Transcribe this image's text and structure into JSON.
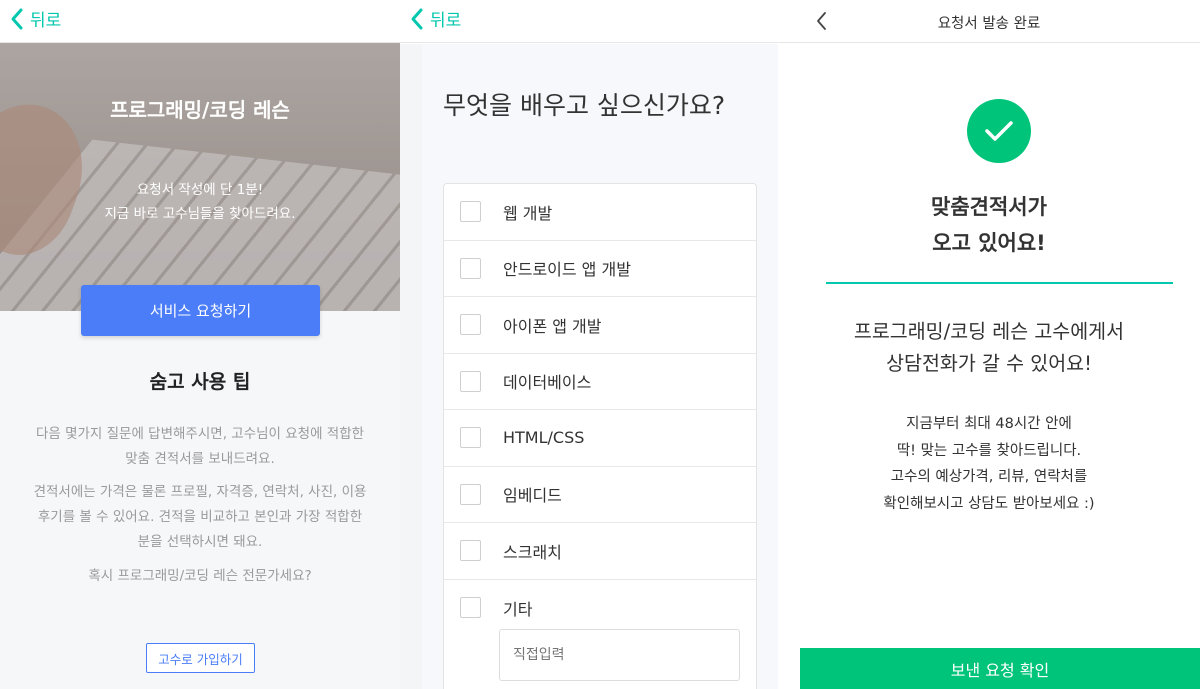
{
  "panel1": {
    "back_label": "뒤로",
    "hero": {
      "title": "프로그래밍/코딩 레슨",
      "subtitle_line1": "요청서 작성에 단 1분!",
      "subtitle_line2": "지금 바로 고수님들을 찾아드려요.",
      "cta_label": "서비스 요청하기"
    },
    "tips": {
      "title": "숨고 사용 팁",
      "p1_line1": "다음 몇가지 질문에 답변해주시면, 고수님이 요청에 적합한",
      "p1_line2": "맞춤 견적서를 보내드려요.",
      "p2_line1": "견적서에는 가격은 물론 프로필, 자격증, 연락처, 사진, 이용",
      "p2_line2": "후기를 볼 수 있어요. 견적을 비교하고 본인과 가장 적합한",
      "p2_line3": "분을 선택하시면 돼요.",
      "p3": "혹시 프로그래밍/코딩 레슨 전문가세요?",
      "join_label": "고수로 가입하기"
    }
  },
  "panel2": {
    "back_label": "뒤로",
    "question": "무엇을 배우고 싶으신가요?",
    "options": [
      {
        "label": "웹 개발"
      },
      {
        "label": "안드로이드 앱 개발"
      },
      {
        "label": "아이폰 앱 개발"
      },
      {
        "label": "데이터베이스"
      },
      {
        "label": "HTML/CSS"
      },
      {
        "label": "임베디드"
      },
      {
        "label": "스크래치"
      },
      {
        "label": "기타"
      }
    ],
    "direct_input_placeholder": "직접입력"
  },
  "panel3": {
    "title": "요청서 발송 완료",
    "heading_line1": "맞춤견적서가",
    "heading_line2": "오고 있어요!",
    "sub_line1": "프로그래밍/코딩 레슨 고수에게서",
    "sub_line2": "상담전화가 갈 수 있어요!",
    "body_line1": "지금부터 최대 48시간 안에",
    "body_line2": "딱! 맞는 고수를 찾아드립니다.",
    "body_line3": "고수의 예상가격, 리뷰, 연락처를",
    "body_line4": "확인해보시고 상담도 받아보세요 :)",
    "confirm_label": "보낸 요청 확인"
  },
  "colors": {
    "teal": "#00c7ae",
    "green": "#00c47a",
    "blue": "#4a7df7"
  }
}
